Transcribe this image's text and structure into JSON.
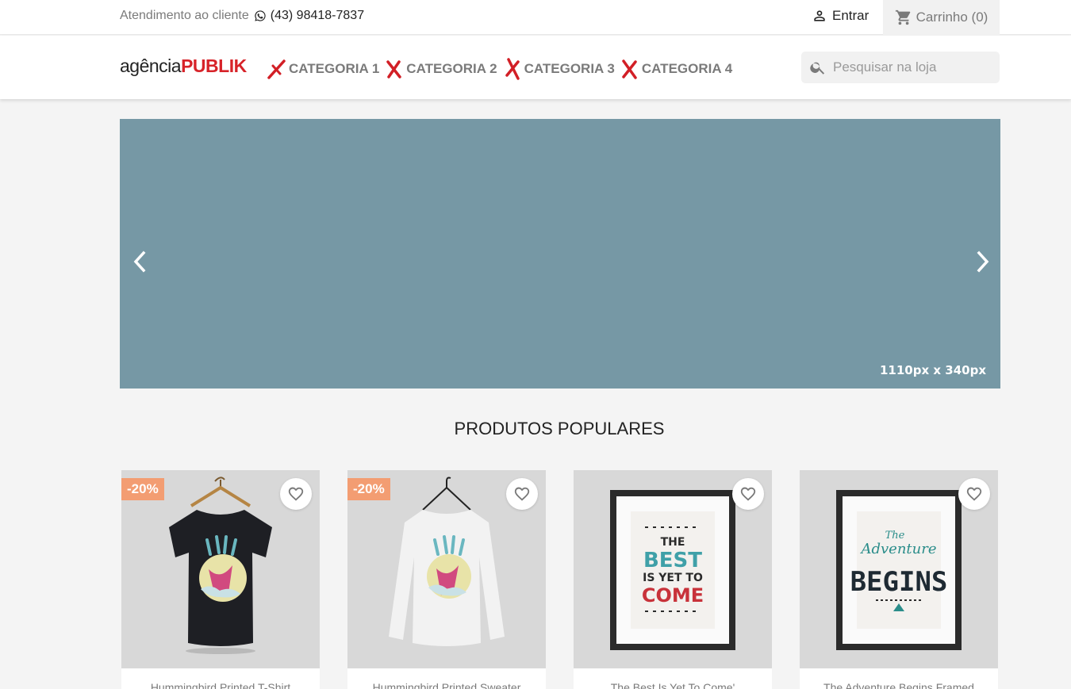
{
  "topbar": {
    "contact_label": "Atendimento ao cliente",
    "phone": "(43) 98418-7837",
    "signin_label": "Entrar",
    "cart_label": "Carrinho (0)"
  },
  "header": {
    "logo_part1": "agência",
    "logo_part2": "PUBLIK",
    "menu": [
      {
        "label": "CATEGORIA 1"
      },
      {
        "label": "CATEGORIA 2"
      },
      {
        "label": "CATEGORIA 3"
      },
      {
        "label": "CATEGORIA 4"
      }
    ],
    "search_placeholder": "Pesquisar na loja"
  },
  "slider": {
    "dimension_label": "1110px x 340px",
    "color": "#7698a5"
  },
  "section": {
    "title": "PRODUTOS POPULARES"
  },
  "products": [
    {
      "name": "Hummingbird Printed T-Shirt",
      "discount": "-20%"
    },
    {
      "name": "Hummingbird Printed Sweater",
      "discount": "-20%"
    },
    {
      "name": "The Best Is Yet To Come'",
      "discount": ""
    },
    {
      "name": "The Adventure Begins Framed",
      "discount": ""
    }
  ],
  "colors": {
    "brand_red": "#d72329",
    "discount_flag": "#f39d72",
    "muted_text": "#7a7a7a"
  }
}
